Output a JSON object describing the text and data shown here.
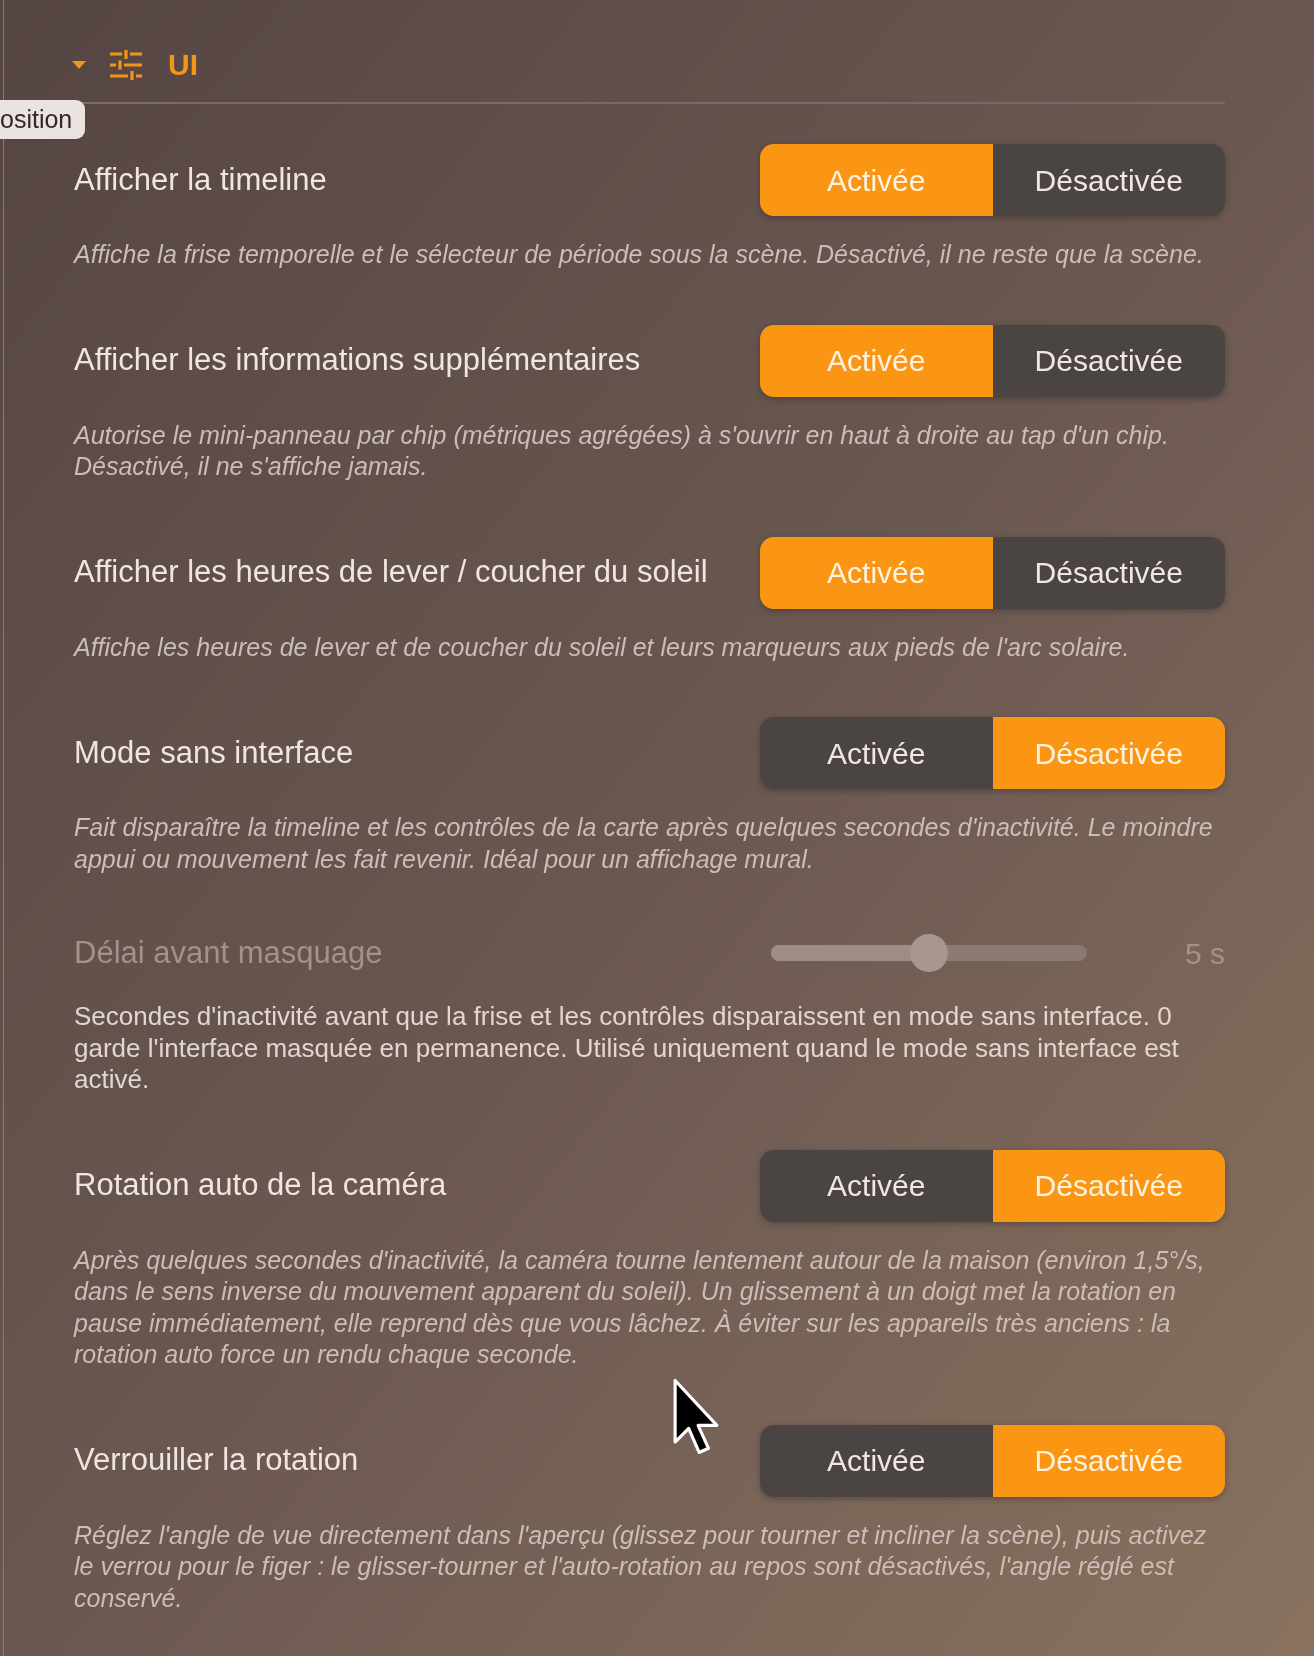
{
  "section": {
    "title": "UI",
    "expanded": true
  },
  "tooltip": {
    "text": "osition"
  },
  "settings": [
    {
      "kind": "toggle",
      "label": "Afficher la timeline",
      "options": [
        {
          "label": "Activée",
          "selected": true
        },
        {
          "label": "Désactivée",
          "selected": false
        }
      ],
      "description": "Affiche la frise temporelle et le sélecteur de période sous la scène. Désactivé, il ne reste que la scène."
    },
    {
      "kind": "toggle",
      "label": "Afficher les informations supplémentaires",
      "options": [
        {
          "label": "Activée",
          "selected": true
        },
        {
          "label": "Désactivée",
          "selected": false
        }
      ],
      "description": "Autorise le mini-panneau par chip (métriques agrégées) à s'ouvrir en haut à droite au tap d'un chip. Désactivé, il ne s'affiche jamais."
    },
    {
      "kind": "toggle",
      "label": "Afficher les heures de lever / coucher du soleil",
      "options": [
        {
          "label": "Activée",
          "selected": true
        },
        {
          "label": "Désactivée",
          "selected": false
        }
      ],
      "description": "Affiche les heures de lever et de coucher du soleil et leurs marqueurs aux pieds de l'arc solaire."
    },
    {
      "kind": "toggle",
      "label": "Mode sans interface",
      "options": [
        {
          "label": "Activée",
          "selected": false
        },
        {
          "label": "Désactivée",
          "selected": true
        }
      ],
      "description": "Fait disparaître la timeline et les contrôles de la carte après quelques secondes d'inactivité. Le moindre appui ou mouvement les fait revenir. Idéal pour un affichage mural."
    },
    {
      "kind": "slider",
      "label": "Délai avant masquage",
      "disabled": true,
      "level": 0.5,
      "reading": "5 s",
      "description": "Secondes d'inactivité avant que la frise et les contrôles disparaissent en mode sans interface. 0 garde l'interface masquée en permanence. Utilisé uniquement quand le mode sans interface est activé."
    },
    {
      "kind": "toggle",
      "label": "Rotation auto de la caméra",
      "options": [
        {
          "label": "Activée",
          "selected": false
        },
        {
          "label": "Désactivée",
          "selected": true
        }
      ],
      "description": "Après quelques secondes d'inactivité, la caméra tourne lentement autour de la maison (environ 1,5°/s, dans le sens inverse du mouvement apparent du soleil). Un glissement à un doigt met la rotation en pause immédiatement, elle reprend dès que vous lâchez. À éviter sur les appareils très anciens : la rotation auto force un rendu chaque seconde."
    },
    {
      "kind": "toggle",
      "label": "Verrouiller la rotation",
      "options": [
        {
          "label": "Activée",
          "selected": false
        },
        {
          "label": "Désactivée",
          "selected": true
        }
      ],
      "description": "Réglez l'angle de vue directement dans l'aperçu (glissez pour tourner et incliner la scène), puis activez le verrou pour le figer : le glisser-tourner et l'auto-rotation au repos sont désactivés, l'angle réglé est conservé."
    }
  ]
}
